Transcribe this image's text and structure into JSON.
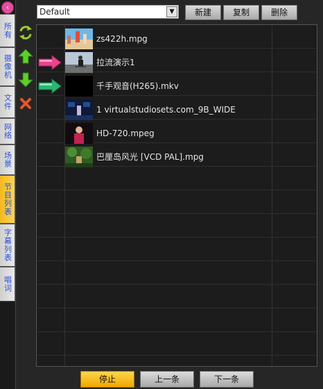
{
  "left_tabs": [
    {
      "label": "所有",
      "active": false
    },
    {
      "label": "摄像机",
      "active": false
    },
    {
      "label": "文件",
      "active": false
    },
    {
      "label": "网络",
      "active": false
    },
    {
      "label": "场景",
      "active": false
    },
    {
      "label": "节目列表",
      "active": true
    },
    {
      "label": "字幕列表",
      "active": false
    },
    {
      "label": "唱词",
      "active": false
    }
  ],
  "tools": [
    "refresh-icon",
    "move-up-icon",
    "move-down-icon",
    "delete-icon"
  ],
  "topbar": {
    "playlist_selected": "Default",
    "new_label": "新建",
    "copy_label": "复制",
    "delete_label": "删除"
  },
  "playlist": {
    "items": [
      {
        "name": "zs422h.mpg",
        "thumbnail": "beach-volleyball-thumbnail",
        "marker": ""
      },
      {
        "name": "拉流演示1",
        "thumbnail": "skater-thumbnail",
        "marker": "now-playing-pink-arrow"
      },
      {
        "name": "千手观音(H265).mkv",
        "thumbnail": "black-thumbnail",
        "marker": "next-cue-green-arrow"
      },
      {
        "name": "1 virtualstudiosets.com_9B_WIDE",
        "thumbnail": "studio-set-thumbnail",
        "marker": ""
      },
      {
        "name": "HD-720.mpeg",
        "thumbnail": "presenter-thumbnail",
        "marker": ""
      },
      {
        "name": "巴厘岛风光 [VCD PAL].mpg",
        "thumbnail": "tropical-thumbnail",
        "marker": ""
      }
    ]
  },
  "transport": {
    "stop_label": "停止",
    "prev_label": "上一条",
    "next_label": "下一条"
  },
  "colors": {
    "active_tab": "#f2b91e",
    "stop_button": "#f0a800",
    "pink_marker": "#e8468a",
    "green_marker": "#2bb673",
    "tab_text": "#2d4fd0"
  }
}
